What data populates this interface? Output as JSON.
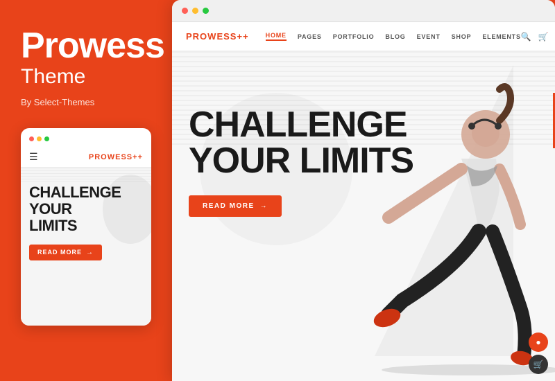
{
  "left": {
    "title": "Prowess",
    "subtitle": "Theme",
    "by": "By Select-Themes",
    "mobile_dots": [
      "dot1",
      "dot2",
      "dot3"
    ],
    "mobile_logo": "PROWESS",
    "mobile_logo_suffix": "++",
    "mobile_hero_title_line1": "CHALLENGE",
    "mobile_hero_title_line2": "YOUR",
    "mobile_hero_title_line3": "LIMITS",
    "mobile_read_more": "READ MORE"
  },
  "right": {
    "browser_dots": [
      "dot1",
      "dot2",
      "dot3"
    ],
    "site_logo": "PROWESS",
    "site_logo_suffix": "++",
    "nav_items": [
      {
        "label": "HOME",
        "active": true
      },
      {
        "label": "PAGES",
        "active": false
      },
      {
        "label": "PORTFOLIO",
        "active": false
      },
      {
        "label": "BLOG",
        "active": false
      },
      {
        "label": "EVENT",
        "active": false
      },
      {
        "label": "SHOP",
        "active": false
      },
      {
        "label": "ELEMENTS",
        "active": false
      }
    ],
    "hero_title_line1": "CHALLENGE",
    "hero_title_line2": "YOUR LIMITS",
    "hero_read_more": "READ MORE",
    "hero_arrow": "→"
  },
  "accent_color": "#e8431a"
}
